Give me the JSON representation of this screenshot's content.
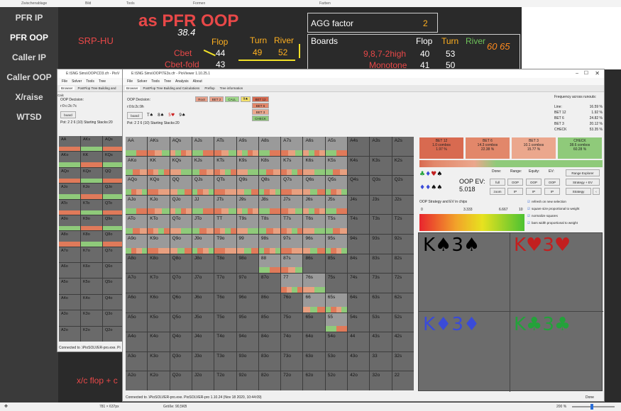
{
  "ribbon": [
    "Zwischenablage",
    "Bild",
    "Tools",
    "Formen",
    "Farben"
  ],
  "nav": [
    {
      "label": "PFR IP"
    },
    {
      "label": "PFR OOP"
    },
    {
      "label": "Caller IP"
    },
    {
      "label": "Caller OOP"
    },
    {
      "label": "X/raise"
    },
    {
      "label": "WTSD"
    }
  ],
  "slide": {
    "title": "as PFR OOP",
    "scenario": "SRP-HU",
    "handwritten": "38.4",
    "head_flop": "Flop",
    "head_turn": "Turn",
    "head_river": "River",
    "cbet_label": "Cbet",
    "cbet_flop": "44",
    "cbet_turn": "49",
    "cbet_river": "52",
    "cbetfold_label": "Cbet-fold",
    "cbetfold_flop": "43",
    "agg_label": "AGG factor",
    "agg_value": "2",
    "boards_label": "Boards",
    "b_flop": "Flop",
    "b_turn": "Turn",
    "b_river": "River",
    "row1_label": "9,8,7-2high",
    "row1_flop": "40",
    "row1_turn": "53",
    "row2_label": "Monotone",
    "row2_flop": "41",
    "row2_turn": "50",
    "note1": "60 65",
    "bottom_text": "x/c flop + c"
  },
  "win_back": {
    "title": "E:\\SNG Sims\\OOP\\CD3.cfr - PioV",
    "menu": [
      "File",
      "Solver",
      "Tools",
      "Tree",
      "Analysis"
    ],
    "tabs": [
      "Browser",
      "PostFlop Tree Building and Calc"
    ],
    "decision": "OOP Decision:",
    "line": "r:0:c:2c:7c",
    "board_btn": "board",
    "pot": "Pot: 2 2 6 (10) Starting Stacks:20",
    "status": "Connected to .\\PioSOLVER-pro.exe. Pi",
    "col1": [
      "AA",
      "AKo",
      "AQo",
      "AJo",
      "ATo",
      "A9o",
      "A8o",
      "A7o",
      "A6o",
      "A5o",
      "A4o",
      "A3o",
      "A2o"
    ],
    "col2": [
      "AKs",
      "KK",
      "KQo",
      "KJo",
      "KTo",
      "K9o",
      "K8o",
      "K7o",
      "K6o",
      "K5o",
      "K4o",
      "K3o",
      "K2o"
    ],
    "col3": [
      "AQs",
      "KQs",
      "QQ",
      "QJo",
      "QTo",
      "Q9o",
      "Q8o",
      "Q7o",
      "Q6o",
      "Q5o",
      "Q4o",
      "Q3o",
      "Q2o"
    ]
  },
  "win_main": {
    "title": "E:\\SNG Sims\\OOP\\TE3s.cfr - PioViewer 1.10.25.1",
    "menu": [
      "File",
      "Solver",
      "Tools",
      "Tree",
      "Analysis",
      "About"
    ],
    "tabs": [
      "Browser",
      "PostFlop Tree Building and Calculations",
      "Preflop",
      "Tree information"
    ],
    "decision": "OOP Decision:",
    "line": "r:0:b:2c:9h",
    "board_btn": "board",
    "board_cards": [
      "T♠",
      "8♠",
      "5♥",
      "9♠"
    ],
    "pot": "Pot: 2 2 6 (10) Starting Stacks:20",
    "tree_nodes": [
      "Root",
      "BET 2",
      "CALL",
      "9♠"
    ],
    "tree_children": [
      "BET 12",
      "BET 6",
      "BET 3",
      "CHECK"
    ],
    "freq_title": "Frequency across runouts:",
    "freqs": [
      {
        "label": "Line:",
        "value": "16.59 %"
      },
      {
        "label": "BET 12",
        "value": "1.92 %"
      },
      {
        "label": "BET 6",
        "value": "24.82 %"
      },
      {
        "label": "BET 3",
        "value": "20.12 %"
      },
      {
        "label": "CHECK",
        "value": "53.35 %"
      }
    ],
    "strategies": [
      {
        "name": "BET 12",
        "combos": "1.0 combos",
        "pct": "1.97 %",
        "color": "#d86a50"
      },
      {
        "name": "BET 6",
        "combos": "14.3 combos",
        "pct": "22.38 %",
        "color": "#e2876a"
      },
      {
        "name": "BET 3",
        "combos": "10.1 combos",
        "pct": "15.77 %",
        "color": "#eba78d"
      },
      {
        "name": "CHECK",
        "combos": "38.6 combos",
        "pct": "60.28 %",
        "color": "#8fca7a"
      }
    ],
    "ev_label": "OOP EV:",
    "ev_value": "5.018",
    "ctrl_labels": [
      "Done:",
      "Range:",
      "Equity:",
      "EV:"
    ],
    "ctrl_buttons": [
      "full",
      "OOP",
      "OOP",
      "OOP",
      "zoom",
      "IP",
      "IP",
      "IP"
    ],
    "side_buttons": [
      "Range Explorer",
      "Strategy + EV",
      "Strategy"
    ],
    "scale_title": "OOP Strategy and EV in chips",
    "scale_ticks": [
      "0",
      "3.333",
      "6.667",
      "10"
    ],
    "options": [
      "refresh on new selection",
      "square size proportional to weight",
      "normalize squares",
      "bars width proportional to weight"
    ],
    "cards": [
      {
        "text": "K♠3♠",
        "color": "#000000"
      },
      {
        "text": "K♥3♥",
        "color": "#c21f1f"
      },
      {
        "text": "K♦3♦",
        "color": "#3a4bd8"
      },
      {
        "text": "K♣3♣",
        "color": "#23a23a"
      }
    ],
    "status": "Connected to .\\PioSOLVER-pro.exe. PioSOLVER-pro 1.10.24 (Nov 18 2020, 10:44:09)",
    "done": "Done",
    "ranks": [
      "A",
      "K",
      "Q",
      "J",
      "T",
      "9",
      "8",
      "7",
      "6",
      "5",
      "4",
      "3",
      "2"
    ]
  },
  "statusbar": {
    "dims": "781 × 637px",
    "size": "Größe: 90,5KB",
    "zoom": "200 %"
  }
}
